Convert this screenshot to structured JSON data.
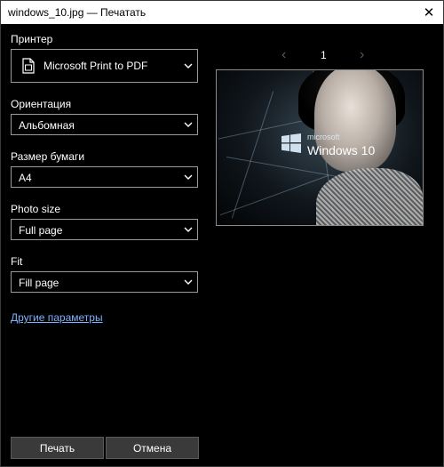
{
  "window": {
    "title": "windows_10.jpg — Печатать"
  },
  "printer": {
    "label": "Принтер",
    "value": "Microsoft Print to PDF"
  },
  "orientation": {
    "label": "Ориентация",
    "value": "Альбомная"
  },
  "paper_size": {
    "label": "Размер бумаги",
    "value": "A4"
  },
  "photo_size": {
    "label": "Photo size",
    "value": "Full page"
  },
  "fit": {
    "label": "Fit",
    "value": "Fill page"
  },
  "more_settings": "Другие параметры",
  "buttons": {
    "print": "Печать",
    "cancel": "Отмена"
  },
  "preview": {
    "page": "1",
    "brand_small": "microsoft",
    "brand_big": "Windows 10"
  },
  "colors": {
    "background": "#000000",
    "accent_link": "#7fb0ff",
    "button": "#3a3a3a"
  },
  "icons": [
    "close-icon",
    "printer-icon",
    "chevron-down-icon",
    "chevron-left-icon",
    "chevron-right-icon",
    "windows-logo-icon"
  ]
}
